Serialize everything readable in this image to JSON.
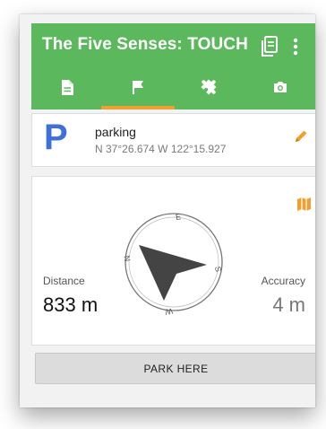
{
  "app": {
    "title": "The Five Senses: TOUCH"
  },
  "tabs": [
    {
      "name": "details",
      "icon": "document-icon"
    },
    {
      "name": "navigate",
      "icon": "flag-icon",
      "active": true
    },
    {
      "name": "puzzle",
      "icon": "puzzle-icon"
    },
    {
      "name": "photo",
      "icon": "camera-icon"
    }
  ],
  "waypoint": {
    "letter": "P",
    "name": "parking",
    "coordinates": "N 37°26.674 W 122°15.927"
  },
  "compass": {
    "north": "N",
    "east": "E",
    "south": "S",
    "west": "W"
  },
  "distance": {
    "label": "Distance",
    "value": "833 m"
  },
  "accuracy": {
    "label": "Accuracy",
    "value": "4 m"
  },
  "actions": {
    "park_here": "PARK HERE"
  },
  "colors": {
    "appbar": "#5cb85c",
    "accent": "#f0a030",
    "letter": "#3f6fd8"
  }
}
